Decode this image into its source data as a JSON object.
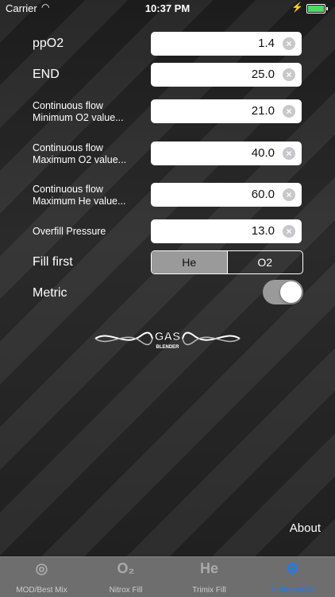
{
  "status": {
    "carrier": "Carrier",
    "time": "10:37 PM"
  },
  "fields": [
    {
      "label": "ppO2",
      "value": "1.4"
    },
    {
      "label": "END",
      "value": "25.0"
    },
    {
      "label_line1": "Continuous flow",
      "label_line2": "Minimum O2 value...",
      "value": "21.0"
    },
    {
      "label_line1": "Continuous flow",
      "label_line2": "Maximum O2 value...",
      "value": "40.0"
    },
    {
      "label_line1": "Continuous flow",
      "label_line2": "Maximum He value...",
      "value": "60.0"
    },
    {
      "label": "Overfill Pressure",
      "value": "13.0"
    }
  ],
  "fill_first": {
    "label": "Fill first",
    "options": [
      "He",
      "O2"
    ],
    "selected": "He"
  },
  "metric": {
    "label": "Metric",
    "on": true
  },
  "logo": {
    "line1": "GAS",
    "line2": "BLENDER"
  },
  "about": "About",
  "tabs": [
    {
      "icon": "mask-icon",
      "glyph": "◎",
      "label": "MOD/Best Mix"
    },
    {
      "icon": "o2-icon",
      "glyph": "O₂",
      "label": "Nitrox Fill"
    },
    {
      "icon": "he-icon",
      "glyph": "He",
      "label": "Trimix Fill"
    },
    {
      "icon": "gears-icon",
      "glyph": "⚙",
      "label": "Preferences",
      "active": true
    }
  ],
  "colors": {
    "accent": "#1a7cff",
    "toggle_on": "#9a9a9a",
    "tabbar": "#6e6e6e"
  }
}
